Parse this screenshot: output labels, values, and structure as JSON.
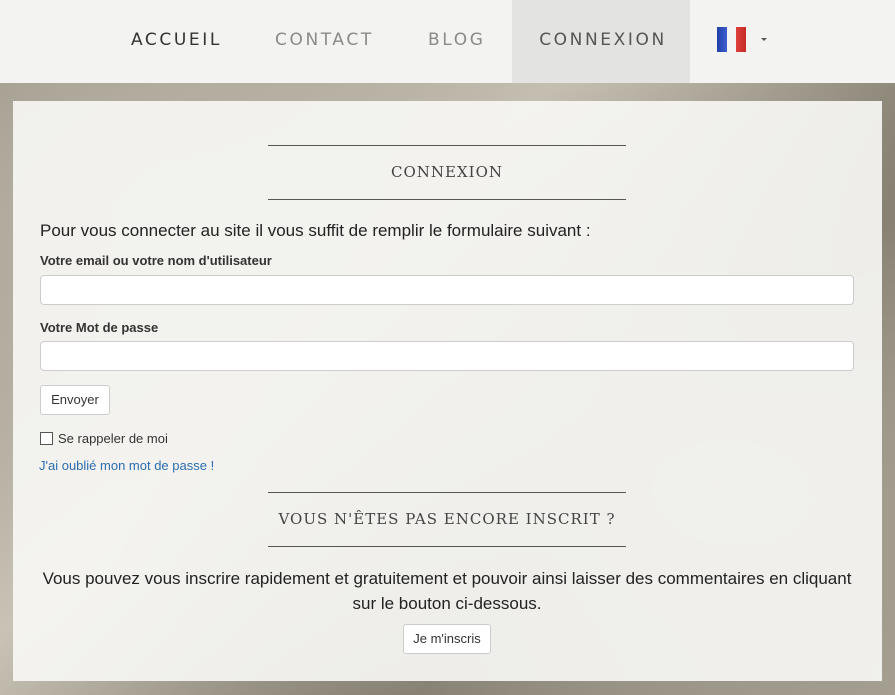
{
  "nav": {
    "items": [
      {
        "label": "ACCUEIL"
      },
      {
        "label": "CONTACT"
      },
      {
        "label": "BLOG"
      },
      {
        "label": "CONNEXION"
      }
    ],
    "language_icon": "flag-france-icon"
  },
  "login": {
    "title": "CONNEXION",
    "intro": "Pour vous connecter au site il vous suffit de remplir le formulaire suivant :",
    "email_label": "Votre email ou votre nom d'utilisateur",
    "email_value": "",
    "password_label": "Votre Mot de passe",
    "password_value": "",
    "submit_label": "Envoyer",
    "remember_label": "Se rappeler de moi",
    "forgot_label": "J'ai oublié mon mot de passe !"
  },
  "signup": {
    "title": "VOUS N'ÊTES PAS ENCORE INSCRIT ?",
    "text": "Vous pouvez vous inscrire rapidement et gratuitement et pouvoir ainsi laisser des commentaires en cliquant sur le bouton ci-dessous.",
    "button_label": "Je m'inscris"
  },
  "colors": {
    "link": "#2a6db0",
    "nav_active_bg": "#e3e3e1"
  }
}
